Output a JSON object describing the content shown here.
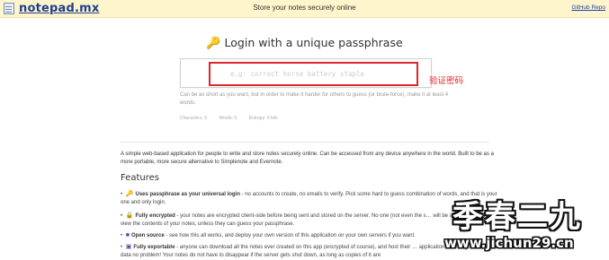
{
  "header": {
    "logo_text": "notepad.mx",
    "logo_icon": "notepad-icon",
    "tagline": "Store your notes securely online",
    "github_link": "GitHub Repo"
  },
  "login": {
    "title": "Login with a unique passphrase",
    "title_icon": "key-icon",
    "placeholder": "e.g: correct horse battery staple",
    "hint": "Can be as short as you want, but in order to make it harder for others to guess (or brute-force), make it at least 4 words.",
    "stats": {
      "characters": "Characters: 0",
      "words": "Words: 0",
      "entropy": "Entropy: 0 bits"
    }
  },
  "annotation": {
    "text": "验证密码",
    "color": "#e0262a"
  },
  "intro": "A simple web-based application for people to write and store notes securely online. Can be accessed from any device anywhere in the world. Built to be as a more portable, more secure alternative to Simplenote and Evernote.",
  "features": {
    "title": "Features",
    "items": [
      {
        "icon": "key-icon",
        "bold": "Uses passphrase as your universal login",
        "text": " - no accounts to create, no emails to verify. Pick some hard to guess combination of words, and that is your one and only login."
      },
      {
        "icon": "lock-icon",
        "bold": "Fully encrypted",
        "text": " - your notes are encrypted client-side before being sent and stored on the server. No one (not even the s… will be able to decrypt or view the contents of your notes, unless they can guess your passphrase."
      },
      {
        "icon": "github-icon",
        "bold": "Open source",
        "text": " - see how this all works, and deploy your own version of this application on your own servers if you want."
      },
      {
        "icon": "save-icon",
        "bold": "Fully exportable",
        "text": " - anyone can download all the notes ever created on this app (encrypted of course), and host their … application including all of its data no problem! Your notes do not have to disappear if the server gets shut down, as long as copies of it are"
      }
    ]
  },
  "watermark": {
    "big": "季春二九",
    "url": "www.jichun29.cn"
  }
}
